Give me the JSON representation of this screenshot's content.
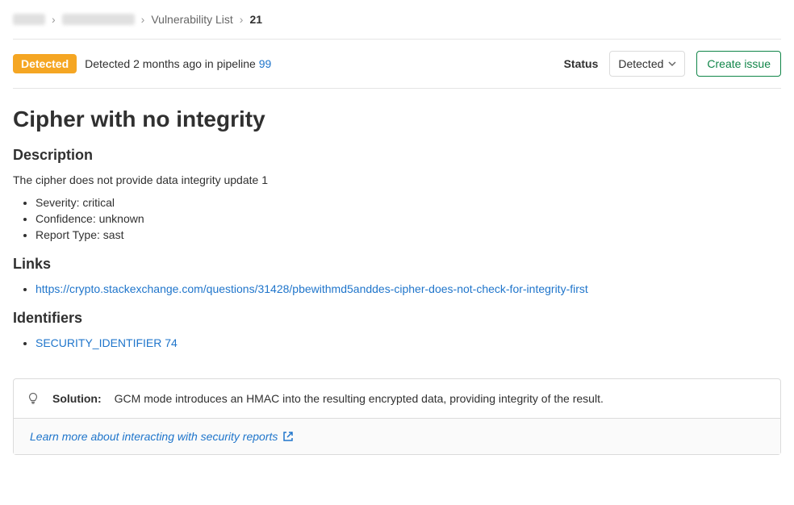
{
  "breadcrumb": {
    "vuln_list": "Vulnerability List",
    "current": "21"
  },
  "header": {
    "badge": "Detected",
    "detected_text": "Detected 2 months ago in pipeline ",
    "pipeline_id": "99",
    "status_label": "Status",
    "dropdown_value": "Detected",
    "create_issue": "Create issue"
  },
  "title": "Cipher with no integrity",
  "description": {
    "heading": "Description",
    "text": "The cipher does not provide data integrity update 1",
    "items": [
      "Severity: critical",
      "Confidence: unknown",
      "Report Type: sast"
    ]
  },
  "links": {
    "heading": "Links",
    "items": [
      "https://crypto.stackexchange.com/questions/31428/pbewithmd5anddes-cipher-does-not-check-for-integrity-first"
    ]
  },
  "identifiers": {
    "heading": "Identifiers",
    "items": [
      "SECURITY_IDENTIFIER 74"
    ]
  },
  "solution": {
    "label": "Solution:",
    "text": "GCM mode introduces an HMAC into the resulting encrypted data, providing integrity of the result.",
    "learn_more": "Learn more about interacting with security reports"
  }
}
